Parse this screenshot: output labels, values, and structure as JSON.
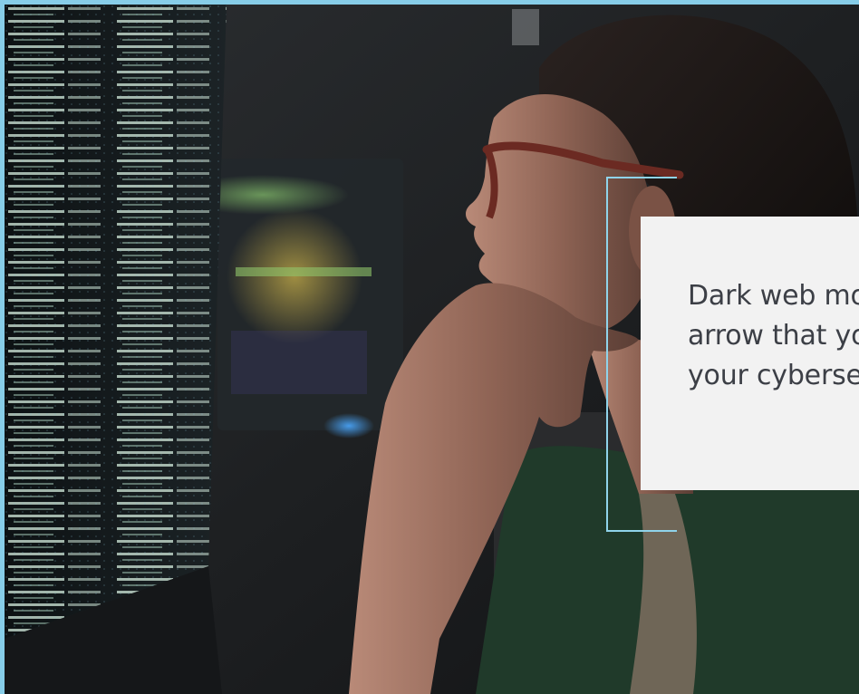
{
  "hero": {
    "image_description_icon": "woman-looking-at-data-screen-photo",
    "callout_text": "Dark web monitoring\narrow that you can\nyour cybersecurity"
  },
  "colors": {
    "page_border": "#87cde8",
    "bracket": "#8fd3ea",
    "panel_bg": "#f2f2f2",
    "text": "#3c3f46",
    "photo_dark": "#1c1d1f"
  }
}
